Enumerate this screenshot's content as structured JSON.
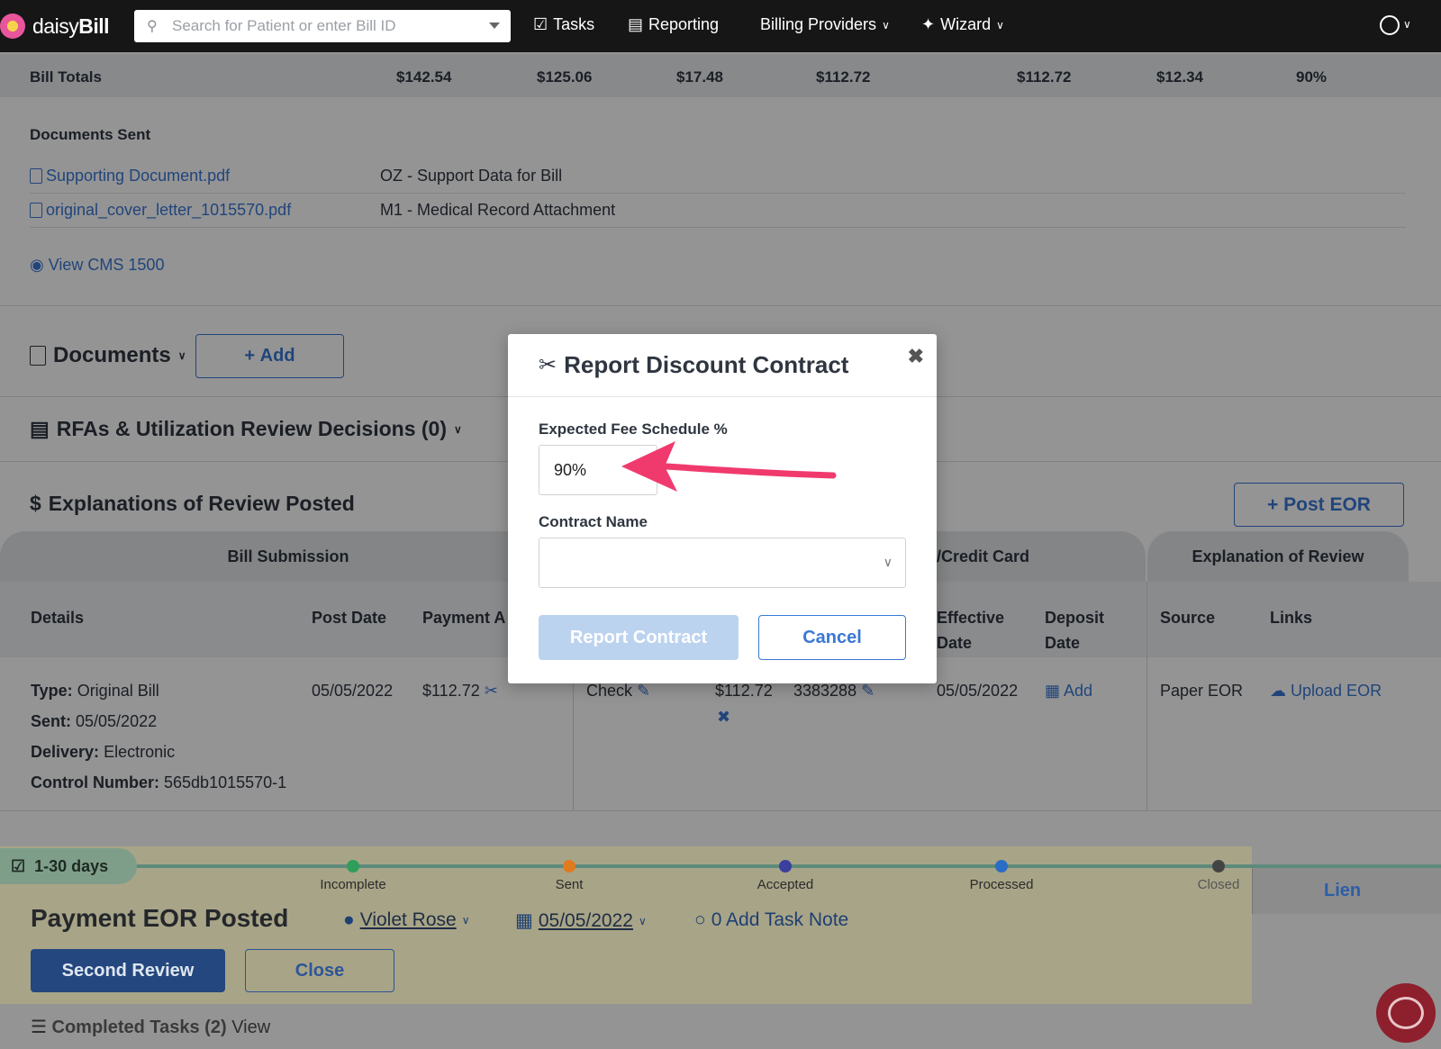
{
  "nav": {
    "logo_text_a": "daisy",
    "logo_text_b": "Bill",
    "search_placeholder": "Search for Patient or enter Bill ID",
    "tasks": "Tasks",
    "reporting": "Reporting",
    "billing_providers": "Billing Providers",
    "wizard": "Wizard"
  },
  "totals": {
    "label": "Bill Totals",
    "values": [
      "$142.54",
      "$125.06",
      "$17.48",
      "$112.72",
      "$112.72",
      "$12.34",
      "90%"
    ]
  },
  "documents_sent": {
    "title": "Documents Sent",
    "rows": [
      {
        "file": "Supporting Document.pdf",
        "code": "OZ - Support Data for Bill"
      },
      {
        "file": "original_cover_letter_1015570.pdf",
        "code": "M1 - Medical Record Attachment"
      }
    ],
    "view_link": "View CMS 1500"
  },
  "sections": {
    "documents": "Documents",
    "add": "Add",
    "rfas": "RFAs & Utilization Review Decisions (0)",
    "eor": "Explanations of Review Posted",
    "post_eor": "Post EOR"
  },
  "table": {
    "group_bill": "Bill Submission",
    "group_card": "/Credit Card",
    "group_eor": "Explanation of Review",
    "headers": {
      "details": "Details",
      "post_date": "Post Date",
      "payment": "Payment A",
      "effective": "Effective Date",
      "deposit": "Deposit Date",
      "source": "Source",
      "links": "Links"
    },
    "row": {
      "type_label": "Type:",
      "type": "Original Bill",
      "sent_label": "Sent:",
      "sent": "05/05/2022",
      "delivery_label": "Delivery:",
      "delivery": "Electronic",
      "control_label": "Control Number:",
      "control": "565db1015570-1",
      "post_date": "05/05/2022",
      "payment": "$112.72",
      "method": "Check",
      "amount": "$112.72",
      "check_no": "3383288",
      "effective": "05/05/2022",
      "deposit_add": "Add",
      "source": "Paper EOR",
      "upload": "Upload EOR"
    }
  },
  "workflow": {
    "badge": "1-30 days",
    "stages": [
      "Incomplete",
      "Sent",
      "Accepted",
      "Processed",
      "Closed"
    ],
    "stage_colors": [
      "#2f9e5a",
      "#e07a1f",
      "#3b3f9e",
      "#2b6cc4",
      "#444444"
    ],
    "title": "Payment EOR Posted",
    "assignee": "Violet Rose",
    "date": "05/05/2022",
    "task_note": "0 Add Task Note",
    "second_review": "Second Review",
    "close": "Close",
    "lien": "Lien",
    "completed": "Completed Tasks (2)",
    "view": "View"
  },
  "modal": {
    "title": "Report Discount Contract",
    "fee_label": "Expected Fee Schedule %",
    "fee_value": "90%",
    "contract_label": "Contract Name",
    "report_button": "Report Contract",
    "cancel_button": "Cancel"
  }
}
